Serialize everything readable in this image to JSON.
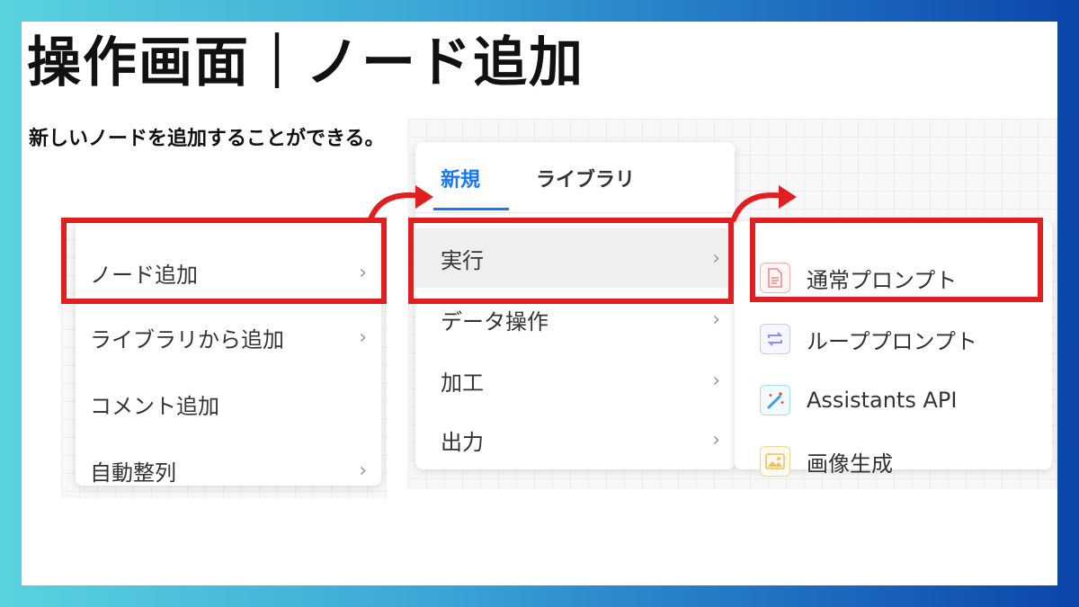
{
  "slide": {
    "title": "操作画面｜ノード追加",
    "subtitle": "新しいノードを追加することができる。"
  },
  "context_menu": {
    "items": [
      {
        "label": "ノード追加",
        "has_submenu": true
      },
      {
        "label": "ライブラリから追加",
        "has_submenu": true
      },
      {
        "label": "コメント追加",
        "has_submenu": false
      },
      {
        "label": "自動整列",
        "has_submenu": true
      }
    ]
  },
  "submenu": {
    "tabs": [
      {
        "label": "新規",
        "active": true
      },
      {
        "label": "ライブラリ",
        "active": false
      }
    ],
    "items": [
      {
        "label": "実行",
        "has_submenu": true
      },
      {
        "label": "データ操作",
        "has_submenu": true
      },
      {
        "label": "加工",
        "has_submenu": true
      },
      {
        "label": "出力",
        "has_submenu": true
      }
    ]
  },
  "node_menu": {
    "items": [
      {
        "label": "通常プロンプト",
        "icon": "document-icon",
        "color": "#f08a8a"
      },
      {
        "label": "ループプロンプト",
        "icon": "loop-icon",
        "color": "#8a8ff0"
      },
      {
        "label": "Assistants API",
        "icon": "magic-wand-icon",
        "color": "#5ab8e8"
      },
      {
        "label": "画像生成",
        "icon": "image-icon",
        "color": "#f0c060"
      }
    ]
  },
  "colors": {
    "highlight": "#e02020",
    "tab_active": "#1677ff"
  },
  "chevron": "›"
}
